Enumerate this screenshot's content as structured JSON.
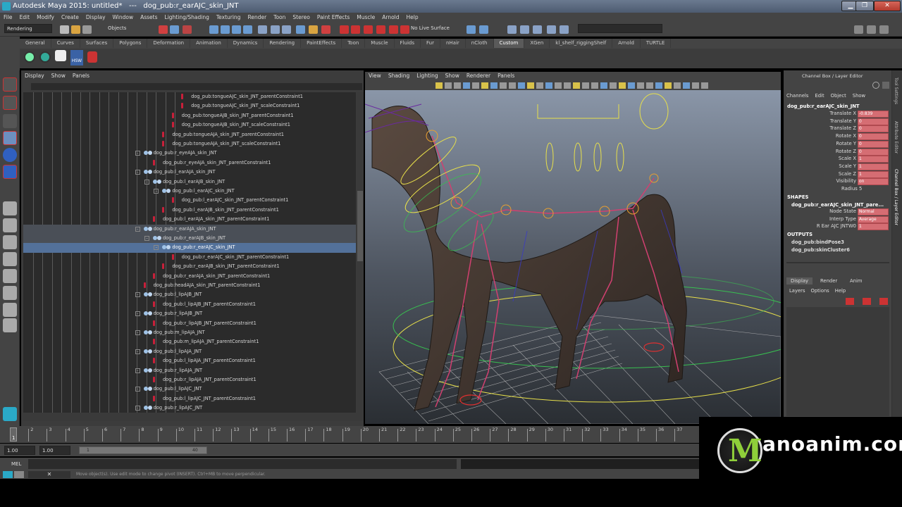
{
  "window": {
    "title": "Autodesk Maya 2015: untitled*   ---   dog_pub:r_earAJC_skin_JNT",
    "min": "▁",
    "max": "❐",
    "close": "✕"
  },
  "menubar": [
    "File",
    "Edit",
    "Modify",
    "Create",
    "Display",
    "Window",
    "Assets",
    "Lighting/Shading",
    "Texturing",
    "Render",
    "Toon",
    "Stereo",
    "Paint Effects",
    "Muscle",
    "Arnold",
    "Help"
  ],
  "statusline": {
    "menuset": "Rendering",
    "selection_mask": "Objects",
    "live_surface": "No Live Surface"
  },
  "shelf": {
    "tabs": [
      "General",
      "Curves",
      "Surfaces",
      "Polygons",
      "Deformation",
      "Animation",
      "Dynamics",
      "Rendering",
      "PaintEffects",
      "Toon",
      "Muscle",
      "Fluids",
      "Fur",
      "nHair",
      "nCloth",
      "Custom",
      "XGen",
      "kl_shelf_riggingShelf",
      "Arnold",
      "TURTLE"
    ],
    "active": "Custom",
    "hsw_label": "HSW"
  },
  "outliner": {
    "menu": [
      "Display",
      "Show",
      "Panels"
    ],
    "rows": [
      {
        "label": "dog_pub:tongueAJC_skin_JNT_parentConstraint1",
        "depth": 13,
        "type": "c",
        "exp": false
      },
      {
        "label": "dog_pub:tongueAJC_skin_JNT_scaleConstraint1",
        "depth": 13,
        "type": "c",
        "exp": false
      },
      {
        "label": "dog_pub:tongueAJB_skin_JNT_parentConstraint1",
        "depth": 12,
        "type": "c",
        "exp": false
      },
      {
        "label": "dog_pub:tongueAJB_skin_JNT_scaleConstraint1",
        "depth": 12,
        "type": "c",
        "exp": false
      },
      {
        "label": "dog_pub:tongueAJA_skin_JNT_parentConstraint1",
        "depth": 11,
        "type": "c",
        "exp": false
      },
      {
        "label": "dog_pub:tongueAJA_skin_JNT_scaleConstraint1",
        "depth": 11,
        "type": "c",
        "exp": false
      },
      {
        "label": "dog_pub:r_eyeAJA_skin_JNT",
        "depth": 9,
        "type": "j",
        "exp": true
      },
      {
        "label": "dog_pub:r_eyeAJA_skin_JNT_parentConstraint1",
        "depth": 10,
        "type": "c",
        "exp": false
      },
      {
        "label": "dog_pub:l_earAJA_skin_JNT",
        "depth": 9,
        "type": "j",
        "exp": true
      },
      {
        "label": "dog_pub:l_earAJB_skin_JNT",
        "depth": 10,
        "type": "j",
        "exp": true
      },
      {
        "label": "dog_pub:l_earAJC_skin_JNT",
        "depth": 11,
        "type": "j",
        "exp": true
      },
      {
        "label": "dog_pub:l_earAJC_skin_JNT_parentConstraint1",
        "depth": 12,
        "type": "c",
        "exp": false
      },
      {
        "label": "dog_pub:l_earAJB_skin_JNT_parentConstraint1",
        "depth": 11,
        "type": "c",
        "exp": false
      },
      {
        "label": "dog_pub:l_earAJA_skin_JNT_parentConstraint1",
        "depth": 10,
        "type": "c",
        "exp": false
      },
      {
        "label": "dog_pub:r_earAJA_skin_JNT",
        "depth": 9,
        "type": "j",
        "exp": true,
        "hl": true
      },
      {
        "label": "dog_pub:r_earAJB_skin_JNT",
        "depth": 10,
        "type": "j",
        "exp": true,
        "hl": true
      },
      {
        "label": "dog_pub:r_earAJC_skin_JNT",
        "depth": 11,
        "type": "j",
        "exp": true,
        "sel": true
      },
      {
        "label": "dog_pub:r_earAJC_skin_JNT_parentConstraint1",
        "depth": 12,
        "type": "c",
        "exp": false
      },
      {
        "label": "dog_pub:r_earAJB_skin_JNT_parentConstraint1",
        "depth": 11,
        "type": "c",
        "exp": false
      },
      {
        "label": "dog_pub:r_earAJA_skin_JNT_parentConstraint1",
        "depth": 10,
        "type": "c",
        "exp": false
      },
      {
        "label": "dog_pub:headAJA_skin_JNT_parentConstraint1",
        "depth": 9,
        "type": "c",
        "exp": false
      },
      {
        "label": "dog_pub:l_lipAJB_JNT",
        "depth": 9,
        "type": "j",
        "exp": true
      },
      {
        "label": "dog_pub:l_lipAJB_JNT_parentConstraint1",
        "depth": 10,
        "type": "c",
        "exp": false
      },
      {
        "label": "dog_pub:r_lipAJB_JNT",
        "depth": 9,
        "type": "j",
        "exp": true
      },
      {
        "label": "dog_pub:r_lipAJB_JNT_parentConstraint1",
        "depth": 10,
        "type": "c",
        "exp": false
      },
      {
        "label": "dog_pub:m_lipAJA_JNT",
        "depth": 9,
        "type": "j",
        "exp": true
      },
      {
        "label": "dog_pub:m_lipAJA_JNT_parentConstraint1",
        "depth": 10,
        "type": "c",
        "exp": false
      },
      {
        "label": "dog_pub:l_lipAJA_JNT",
        "depth": 9,
        "type": "j",
        "exp": true
      },
      {
        "label": "dog_pub:l_lipAJA_JNT_parentConstraint1",
        "depth": 10,
        "type": "c",
        "exp": false
      },
      {
        "label": "dog_pub:r_lipAJA_JNT",
        "depth": 9,
        "type": "j",
        "exp": true
      },
      {
        "label": "dog_pub:r_lipAJA_JNT_parentConstraint1",
        "depth": 10,
        "type": "c",
        "exp": false
      },
      {
        "label": "dog_pub:l_lipAJC_JNT",
        "depth": 9,
        "type": "j",
        "exp": true
      },
      {
        "label": "dog_pub:l_lipAJC_JNT_parentConstraint1",
        "depth": 10,
        "type": "c",
        "exp": false
      },
      {
        "label": "dog_pub:r_lipAJC_JNT",
        "depth": 9,
        "type": "j",
        "exp": true
      }
    ]
  },
  "viewport": {
    "menu": [
      "View",
      "Shading",
      "Lighting",
      "Show",
      "Renderer",
      "Panels"
    ]
  },
  "channelbox": {
    "header": "Channel Box / Layer Editor",
    "menu": [
      "Channels",
      "Edit",
      "Object",
      "Show"
    ],
    "node": "dog_pub:r_earAJC_skin_JNT",
    "attrs": [
      {
        "name": "Translate X",
        "value": "-0.839"
      },
      {
        "name": "Translate Y",
        "value": "0"
      },
      {
        "name": "Translate Z",
        "value": "0"
      },
      {
        "name": "Rotate X",
        "value": "0"
      },
      {
        "name": "Rotate Y",
        "value": "0"
      },
      {
        "name": "Rotate Z",
        "value": "0"
      },
      {
        "name": "Scale X",
        "value": "1"
      },
      {
        "name": "Scale Y",
        "value": "1"
      },
      {
        "name": "Scale Z",
        "value": "1"
      },
      {
        "name": "Visibility",
        "value": "on"
      }
    ],
    "radius": "Radius  5",
    "shapes_header": "SHAPES",
    "shape_node": "dog_pub:r_earAJC_skin_JNT_pare...",
    "shape_attrs": [
      {
        "name": "Node State",
        "value": "Normal"
      },
      {
        "name": "Interp Type",
        "value": "Average"
      },
      {
        "name": "R Ear AJC JNTW0",
        "value": "1"
      }
    ],
    "outputs_header": "OUTPUTS",
    "outputs": [
      "dog_pub:bindPose3",
      "dog_pub:skinCluster6"
    ],
    "layer_tabs": [
      "Display",
      "Render",
      "Anim"
    ],
    "layer_menu": [
      "Layers",
      "Options",
      "Help"
    ],
    "side_tabs": [
      "Tool Settings",
      "Attribute Editor",
      "Channel Box / Layer Editor"
    ]
  },
  "timeline": {
    "ticks": [
      "1",
      "2",
      "3",
      "4",
      "5",
      "6",
      "7",
      "8",
      "9",
      "10",
      "11",
      "12",
      "13",
      "14",
      "15",
      "16",
      "17",
      "18",
      "19",
      "20",
      "21",
      "22",
      "23",
      "24",
      "25",
      "26",
      "27",
      "28",
      "29",
      "30",
      "31",
      "32",
      "33",
      "34",
      "35",
      "36",
      "37"
    ],
    "current": "1",
    "range_start": "1.00",
    "range_start2": "1.00",
    "range_inner_start": "1",
    "range_inner_end": "40"
  },
  "commandline": {
    "label": "MEL"
  },
  "helpline": "Move object(s). Use edit mode to change pivot (INSERT). Ctrl+MB to move perpendicular.",
  "brand": {
    "text": "anoanim.com",
    "logo_letter": "M"
  },
  "colors": {
    "accent": "#53719a",
    "channel_field": "#d56d73",
    "viewport_top": "#8a96a8",
    "viewport_bottom": "#2a2e33"
  }
}
